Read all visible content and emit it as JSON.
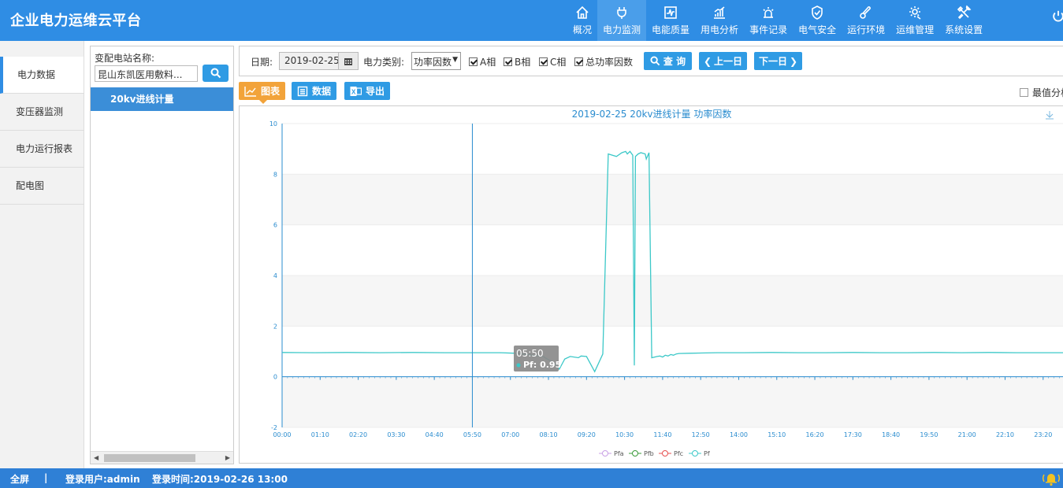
{
  "app": {
    "title": "企业电力运维云平台"
  },
  "nav": [
    {
      "label": "概况",
      "icon": "home-icon"
    },
    {
      "label": "电力监测",
      "icon": "plug-icon",
      "active": true
    },
    {
      "label": "电能质量",
      "icon": "waveform-icon"
    },
    {
      "label": "用电分析",
      "icon": "bar-chart-icon"
    },
    {
      "label": "事件记录",
      "icon": "alarm-light-icon"
    },
    {
      "label": "电气安全",
      "icon": "shield-check-icon"
    },
    {
      "label": "运行环境",
      "icon": "thermometer-icon"
    },
    {
      "label": "运维管理",
      "icon": "gear-icon"
    },
    {
      "label": "系统设置",
      "icon": "tools-icon"
    }
  ],
  "left_menu": [
    "电力数据",
    "变压器监测",
    "电力运行报表",
    "配电图"
  ],
  "station": {
    "label": "变配电站名称:",
    "value": "昆山东凯医用敷料...",
    "node": "20kv进线计量"
  },
  "toolbar": {
    "date_label": "日期:",
    "date_value": "2019-02-25",
    "category_label": "电力类别:",
    "category_value": "功率因数",
    "checks": [
      "A相",
      "B相",
      "C相",
      "总功率因数"
    ],
    "query": "查 询",
    "prev": "上一日",
    "next": "下一日"
  },
  "views": {
    "chart": "图表",
    "data": "数据",
    "export": "导出",
    "extreme": "最值分析"
  },
  "footer": {
    "fullscreen": "全屏",
    "sep": "|",
    "user": "登录用户:admin",
    "login_time": "登录时间:2019-02-26 13:00"
  },
  "colors": {
    "primary": "#2f8de4",
    "pf": "#3cc8c8",
    "pfa": "#c9a0e6",
    "pfb": "#3a9a3a",
    "pfc": "#e65050"
  },
  "chart_data": {
    "type": "line",
    "title": "2019-02-25  20kv进线计量  功率因数",
    "xlabel": "",
    "ylabel": "",
    "ylim": [
      -2,
      10
    ],
    "yticks": [
      -2,
      0,
      2,
      4,
      6,
      8,
      10
    ],
    "xtick_labels": [
      "00:00",
      "01:10",
      "02:20",
      "03:30",
      "04:40",
      "05:50",
      "07:00",
      "08:10",
      "09:20",
      "10:30",
      "11:40",
      "12:50",
      "14:00",
      "15:10",
      "16:20",
      "17:30",
      "18:40",
      "19:50",
      "21:00",
      "22:10",
      "23:20"
    ],
    "legend": [
      "Pfa",
      "Pfb",
      "Pfc",
      "Pf"
    ],
    "legend_position": "bottom",
    "tooltip": {
      "time": "05:50",
      "label": "Pf: 0.95"
    },
    "series": [
      {
        "name": "Pf",
        "x_minutes": [
          0,
          60,
          120,
          180,
          240,
          300,
          350,
          400,
          430,
          460,
          480,
          500,
          510,
          520,
          530,
          545,
          550,
          560,
          575,
          590,
          600,
          615,
          625,
          632,
          635,
          640,
          645,
          648,
          650,
          655,
          660,
          668,
          670,
          675,
          680,
          690,
          695,
          700,
          705,
          710,
          715,
          720,
          725,
          730,
          750,
          800,
          850,
          900,
          950,
          1000,
          1050,
          1100,
          1150,
          1200,
          1250,
          1300,
          1350,
          1400,
          1439
        ],
        "values": [
          0.96,
          0.95,
          0.96,
          0.95,
          0.96,
          0.95,
          0.95,
          0.95,
          0.93,
          0.85,
          0.8,
          0.55,
          0.3,
          0.7,
          0.8,
          0.75,
          0.82,
          0.8,
          0.2,
          0.9,
          8.8,
          8.7,
          8.85,
          8.9,
          8.8,
          8.9,
          8.75,
          0.45,
          8.7,
          8.8,
          8.85,
          8.8,
          8.6,
          8.85,
          0.75,
          0.8,
          0.82,
          0.78,
          0.85,
          0.82,
          0.88,
          0.85,
          0.9,
          0.92,
          0.93,
          0.95,
          0.95,
          0.96,
          0.95,
          0.95,
          0.96,
          0.95,
          0.95,
          0.96,
          0.95,
          0.96,
          0.95,
          0.95,
          0.95
        ]
      },
      {
        "name": "Pfa",
        "values": []
      },
      {
        "name": "Pfb",
        "values": []
      },
      {
        "name": "Pfc",
        "values": []
      }
    ]
  }
}
